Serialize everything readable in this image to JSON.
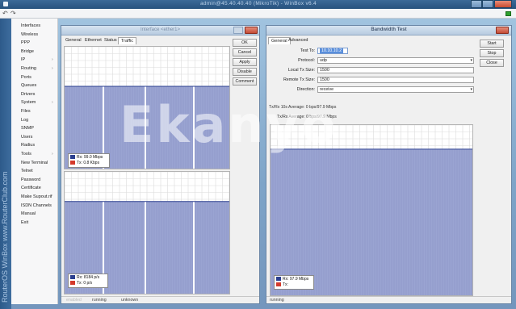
{
  "host": {
    "title": "admin@45.40.40.40 (MikroTik) - WinBox v6.4"
  },
  "toolbar": {
    "undo_icon": "undo-icon",
    "redo_icon": "redo-icon"
  },
  "watermark": "Ekanyo",
  "brand_vertical": "RouterOS WinBox  www.RouterClub.com",
  "sidebar": {
    "items": [
      {
        "label": "Interfaces",
        "submenu": false
      },
      {
        "label": "Wireless",
        "submenu": false
      },
      {
        "label": "PPP",
        "submenu": false
      },
      {
        "label": "Bridge",
        "submenu": false
      },
      {
        "label": "IP",
        "submenu": true
      },
      {
        "label": "Routing",
        "submenu": true
      },
      {
        "label": "Ports",
        "submenu": false
      },
      {
        "label": "Queues",
        "submenu": false
      },
      {
        "label": "Drivers",
        "submenu": false
      },
      {
        "label": "System",
        "submenu": true
      },
      {
        "label": "Files",
        "submenu": false
      },
      {
        "label": "Log",
        "submenu": false
      },
      {
        "label": "SNMP",
        "submenu": false
      },
      {
        "label": "Users",
        "submenu": false
      },
      {
        "label": "Radius",
        "submenu": false
      },
      {
        "label": "Tools",
        "submenu": true
      },
      {
        "label": "New Terminal",
        "submenu": false
      },
      {
        "label": "Telnet",
        "submenu": false
      },
      {
        "label": "Password",
        "submenu": false
      },
      {
        "label": "Certificate",
        "submenu": false
      },
      {
        "label": "Make Supout.rif",
        "submenu": false
      },
      {
        "label": "ISDN Channels",
        "submenu": false
      },
      {
        "label": "Manual",
        "submenu": false
      },
      {
        "label": "Exit",
        "submenu": false
      }
    ]
  },
  "interface_window": {
    "title": "Interface <ether1>",
    "tabs": [
      "General",
      "Ethernet",
      "Status",
      "Traffic"
    ],
    "active_tab": "Traffic",
    "buttons": [
      "OK",
      "Cancel",
      "Apply",
      "Disable",
      "Comment"
    ],
    "graph_top": {
      "rx": "Rx: 99.0 Mbps",
      "tx": "Tx: 0.8 Kbps",
      "fill": 0.68
    },
    "graph_bottom": {
      "rx": "Rx: 8184 p/s",
      "tx": "Tx: 0 p/s",
      "fill": 0.76
    },
    "status": [
      "enabled",
      "running",
      "unknown"
    ]
  },
  "bandwidth_window": {
    "title": "Bandwidth Test",
    "tabs": [
      "General",
      "Advanced"
    ],
    "active_tab": "General",
    "buttons": [
      "Start",
      "Stop",
      "Close"
    ],
    "fields": {
      "test_to_label": "Test To:",
      "test_to_value": "10.10.10.2",
      "protocol_label": "Protocol:",
      "protocol_value": "udp",
      "local_tx_label": "Local Tx Size:",
      "local_tx_value": "1500",
      "remote_tx_label": "Remote Tx Size:",
      "remote_tx_value": "1500",
      "direction_label": "Direction:",
      "direction_value": "receive"
    },
    "rx_avg": "Tx/Rx 10s Average:  0 bps/97.9 Mbps",
    "rx_total": "Tx/Rx Average:  0 bps/97.9 Mbps",
    "graph": {
      "rx": "Rx: 97.9 Mbps",
      "tx": "Tx:",
      "fill": 0.86
    },
    "status": "running"
  },
  "colors": {
    "rx": "#2b3f8f",
    "tx": "#d43a2c",
    "graph_fill": "#9aa4d2"
  }
}
